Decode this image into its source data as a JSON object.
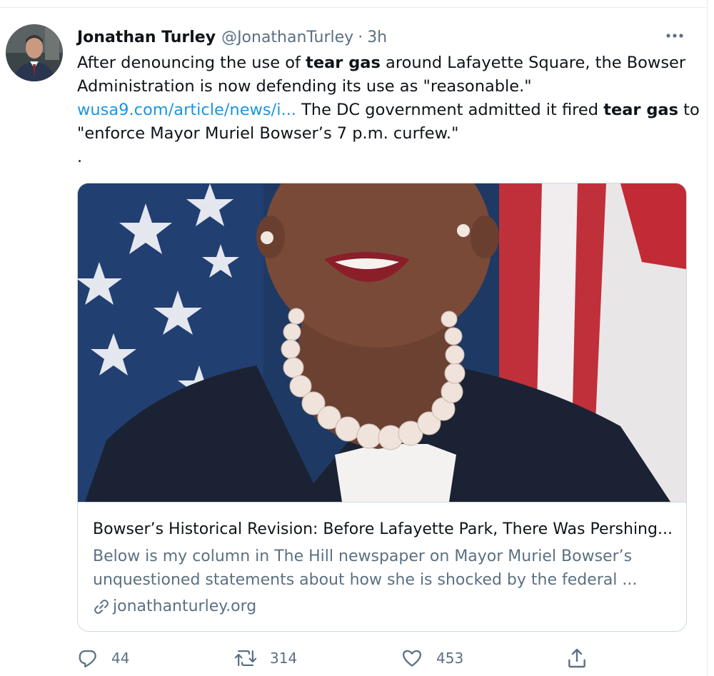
{
  "author": {
    "display_name": "Jonathan Turley",
    "handle": "@JonathanTurley",
    "separator": "·",
    "time": "3h"
  },
  "tweet": {
    "line1_pre": "After denouncing the use of ",
    "line1_bold": "tear gas",
    "line1_post": " around Lafayette Square, the Bowser",
    "line2": "Administration is now defending its use as \"reasonable.\"",
    "line3_link": "wusa9.com/article/news/i...",
    "line3_mid": " The DC government admitted it fired ",
    "line3_bold": "tear gas",
    "line3_post": " to",
    "line4": "\"enforce Mayor Muriel Bowser’s 7 p.m. curfew.\"",
    "line5": "."
  },
  "card": {
    "title": "Bowser’s Historical Revision: Before Lafayette Park, There Was Pershing...",
    "description_line1": "Below is my column in The Hill newspaper on Mayor Muriel Bowser’s",
    "description_line2": "unquestioned statements about how she is shocked by the federal ...",
    "domain": "jonathanturley.org"
  },
  "actions": {
    "reply_count": "44",
    "retweet_count": "314",
    "like_count": "453"
  },
  "icons": {
    "more": "more-icon",
    "reply": "reply-icon",
    "retweet": "retweet-icon",
    "like": "heart-icon",
    "share": "share-icon",
    "link": "link-icon"
  },
  "colors": {
    "link": "#1b95e0",
    "secondary_text": "#5b7083",
    "border": "#cfd9de"
  }
}
